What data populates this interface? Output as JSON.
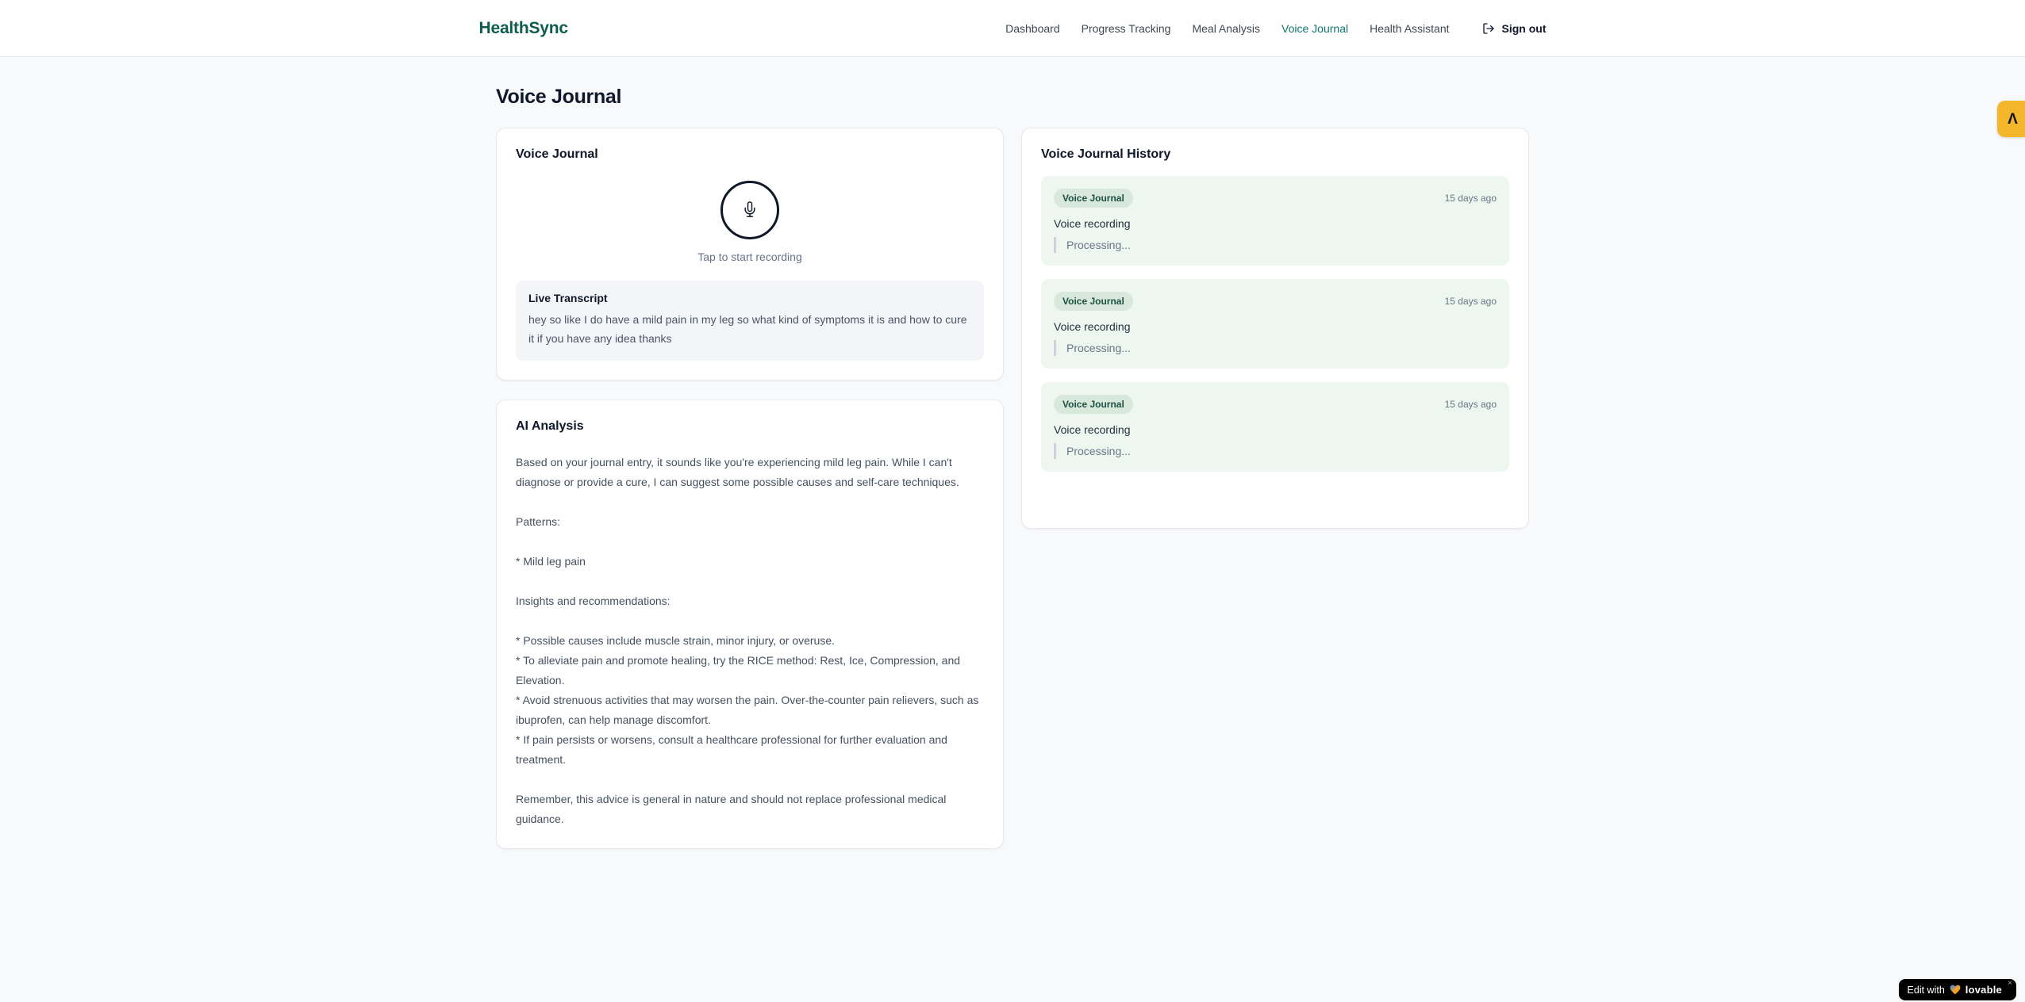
{
  "brand": {
    "name": "HealthSync",
    "color": "#0d5c4f"
  },
  "nav": {
    "items": [
      {
        "label": "Dashboard",
        "active": false
      },
      {
        "label": "Progress Tracking",
        "active": false
      },
      {
        "label": "Meal Analysis",
        "active": false
      },
      {
        "label": "Voice Journal",
        "active": true
      },
      {
        "label": "Health Assistant",
        "active": false
      }
    ],
    "sign_out_label": "Sign out",
    "active_color": "#0f766e"
  },
  "page": {
    "title": "Voice Journal"
  },
  "recorder": {
    "title": "Voice Journal",
    "tap_hint": "Tap to start recording",
    "transcript_title": "Live Transcript",
    "transcript_text": "hey so like I do have a mild pain in my leg so what kind of symptoms it is and how to cure it if you have any idea thanks"
  },
  "analysis": {
    "title": "AI Analysis",
    "body": "Based on your journal entry, it sounds like you're experiencing mild leg pain. While I can't diagnose or provide a cure, I can suggest some possible causes and self-care techniques.\n\nPatterns:\n\n* Mild leg pain\n\nInsights and recommendations:\n\n* Possible causes include muscle strain, minor injury, or overuse.\n* To alleviate pain and promote healing, try the RICE method: Rest, Ice, Compression, and Elevation.\n* Avoid strenuous activities that may worsen the pain. Over-the-counter pain relievers, such as ibuprofen, can help manage discomfort.\n* If pain persists or worsens, consult a healthcare professional for further evaluation and treatment.\n\nRemember, this advice is general in nature and should not replace professional medical guidance."
  },
  "history": {
    "title": "Voice Journal History",
    "entries": [
      {
        "badge": "Voice Journal",
        "time": "15 days ago",
        "label": "Voice recording",
        "status": "Processing..."
      },
      {
        "badge": "Voice Journal",
        "time": "15 days ago",
        "label": "Voice recording",
        "status": "Processing..."
      },
      {
        "badge": "Voice Journal",
        "time": "15 days ago",
        "label": "Voice recording",
        "status": "Processing..."
      }
    ],
    "entry_bg": "#edf6ef",
    "badge_bg": "#d8e9dc",
    "badge_text_color": "#1d5045"
  },
  "overlays": {
    "lovable_text": "Edit with",
    "lovable_brand": "lovable",
    "lovable_close": "×",
    "side_tab_glyph": "Λ",
    "side_tab_color": "#f4b62a"
  }
}
